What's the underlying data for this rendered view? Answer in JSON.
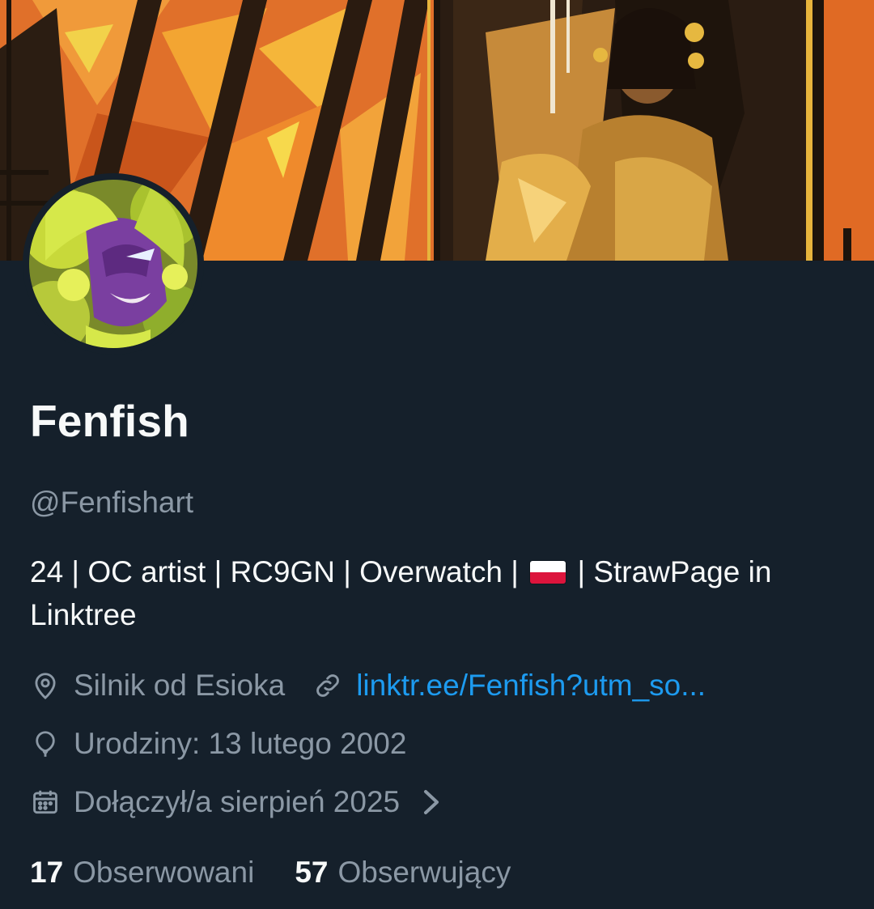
{
  "profile": {
    "display_name": "Fenfish",
    "handle": "@Fenfishart",
    "bio_part1": "24 | OC artist | RC9GN | Overwatch  |",
    "bio_part2": "| StrawPage in Linktree",
    "flag_icon": "poland-flag-icon",
    "location": "Silnik od Esioka",
    "website": "linktr.ee/Fenfish?utm_so...",
    "birthday": "Urodziny: 13 lutego 2002",
    "joined": "Dołączył/a sierpień 2025",
    "following_count": "17",
    "following_label": "Obserwowani",
    "followers_count": "57",
    "followers_label": "Obserwujący"
  },
  "icons": {
    "location": "location-pin-icon",
    "link": "link-icon",
    "birthday": "balloon-icon",
    "joined": "calendar-icon",
    "chevron": "chevron-right-icon"
  },
  "colors": {
    "background": "#15202b",
    "primary_text": "#f7f9f9",
    "secondary_text": "#8b98a5",
    "link": "#1d9bf0",
    "banner_orange": "#d45a1e"
  }
}
